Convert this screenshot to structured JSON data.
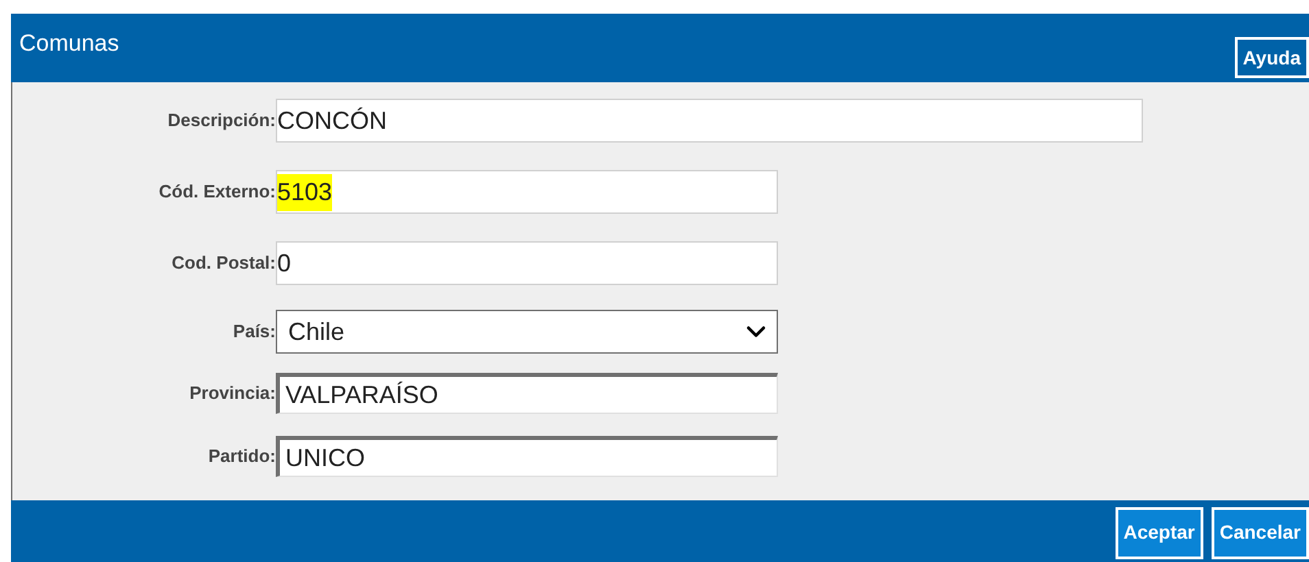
{
  "window": {
    "title": "Comunas"
  },
  "header_buttons": [
    "Ayuda"
  ],
  "fields": [
    {
      "label": "Descripción:",
      "value": "CONCÓN",
      "kind": "wide",
      "highlighted": false
    },
    {
      "label": "Cód. Externo:",
      "value": "5103",
      "kind": "text",
      "highlighted": true
    },
    {
      "label": "Cod. Postal:",
      "value": "0",
      "kind": "text",
      "highlighted": false
    },
    {
      "label": "País:",
      "value": "Chile",
      "kind": "select",
      "highlighted": false
    },
    {
      "label": "Provincia:",
      "value": "VALPARAÍSO",
      "kind": "inset",
      "highlighted": false
    },
    {
      "label": "Partido:",
      "value": "UNICO",
      "kind": "inset",
      "highlighted": false
    }
  ],
  "footer_buttons": [
    "Aceptar",
    "Cancelar"
  ]
}
